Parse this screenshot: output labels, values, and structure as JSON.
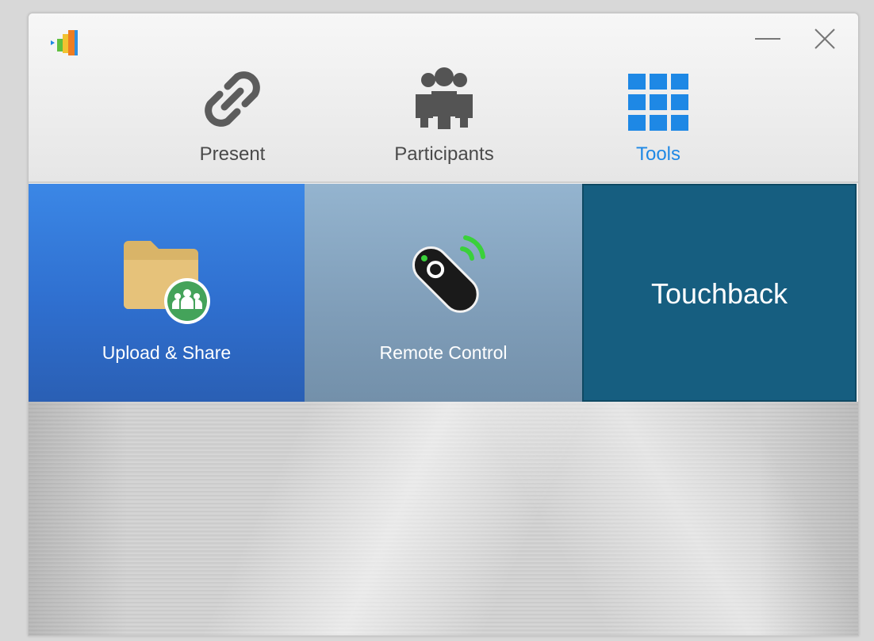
{
  "window": {
    "logo_icon": "app-logo-icon",
    "minimize_icon": "minimize-icon",
    "close_icon": "close-icon"
  },
  "nav": {
    "tabs": [
      {
        "label": "Present",
        "icon": "link-chain-icon",
        "active": false
      },
      {
        "label": "Participants",
        "icon": "people-group-icon",
        "active": false
      },
      {
        "label": "Tools",
        "icon": "grid-icon",
        "active": true
      }
    ]
  },
  "tiles": [
    {
      "label": "Upload & Share",
      "icon": "folder-share-icon",
      "color": "#3b87e6"
    },
    {
      "label": "Remote Control",
      "icon": "remote-control-icon",
      "color": "#8aaac6"
    },
    {
      "label": "Touchback",
      "color": "#165e80"
    }
  ],
  "colors": {
    "active_tab": "#1e88e5",
    "inactive_tab": "#4a4a4a"
  }
}
